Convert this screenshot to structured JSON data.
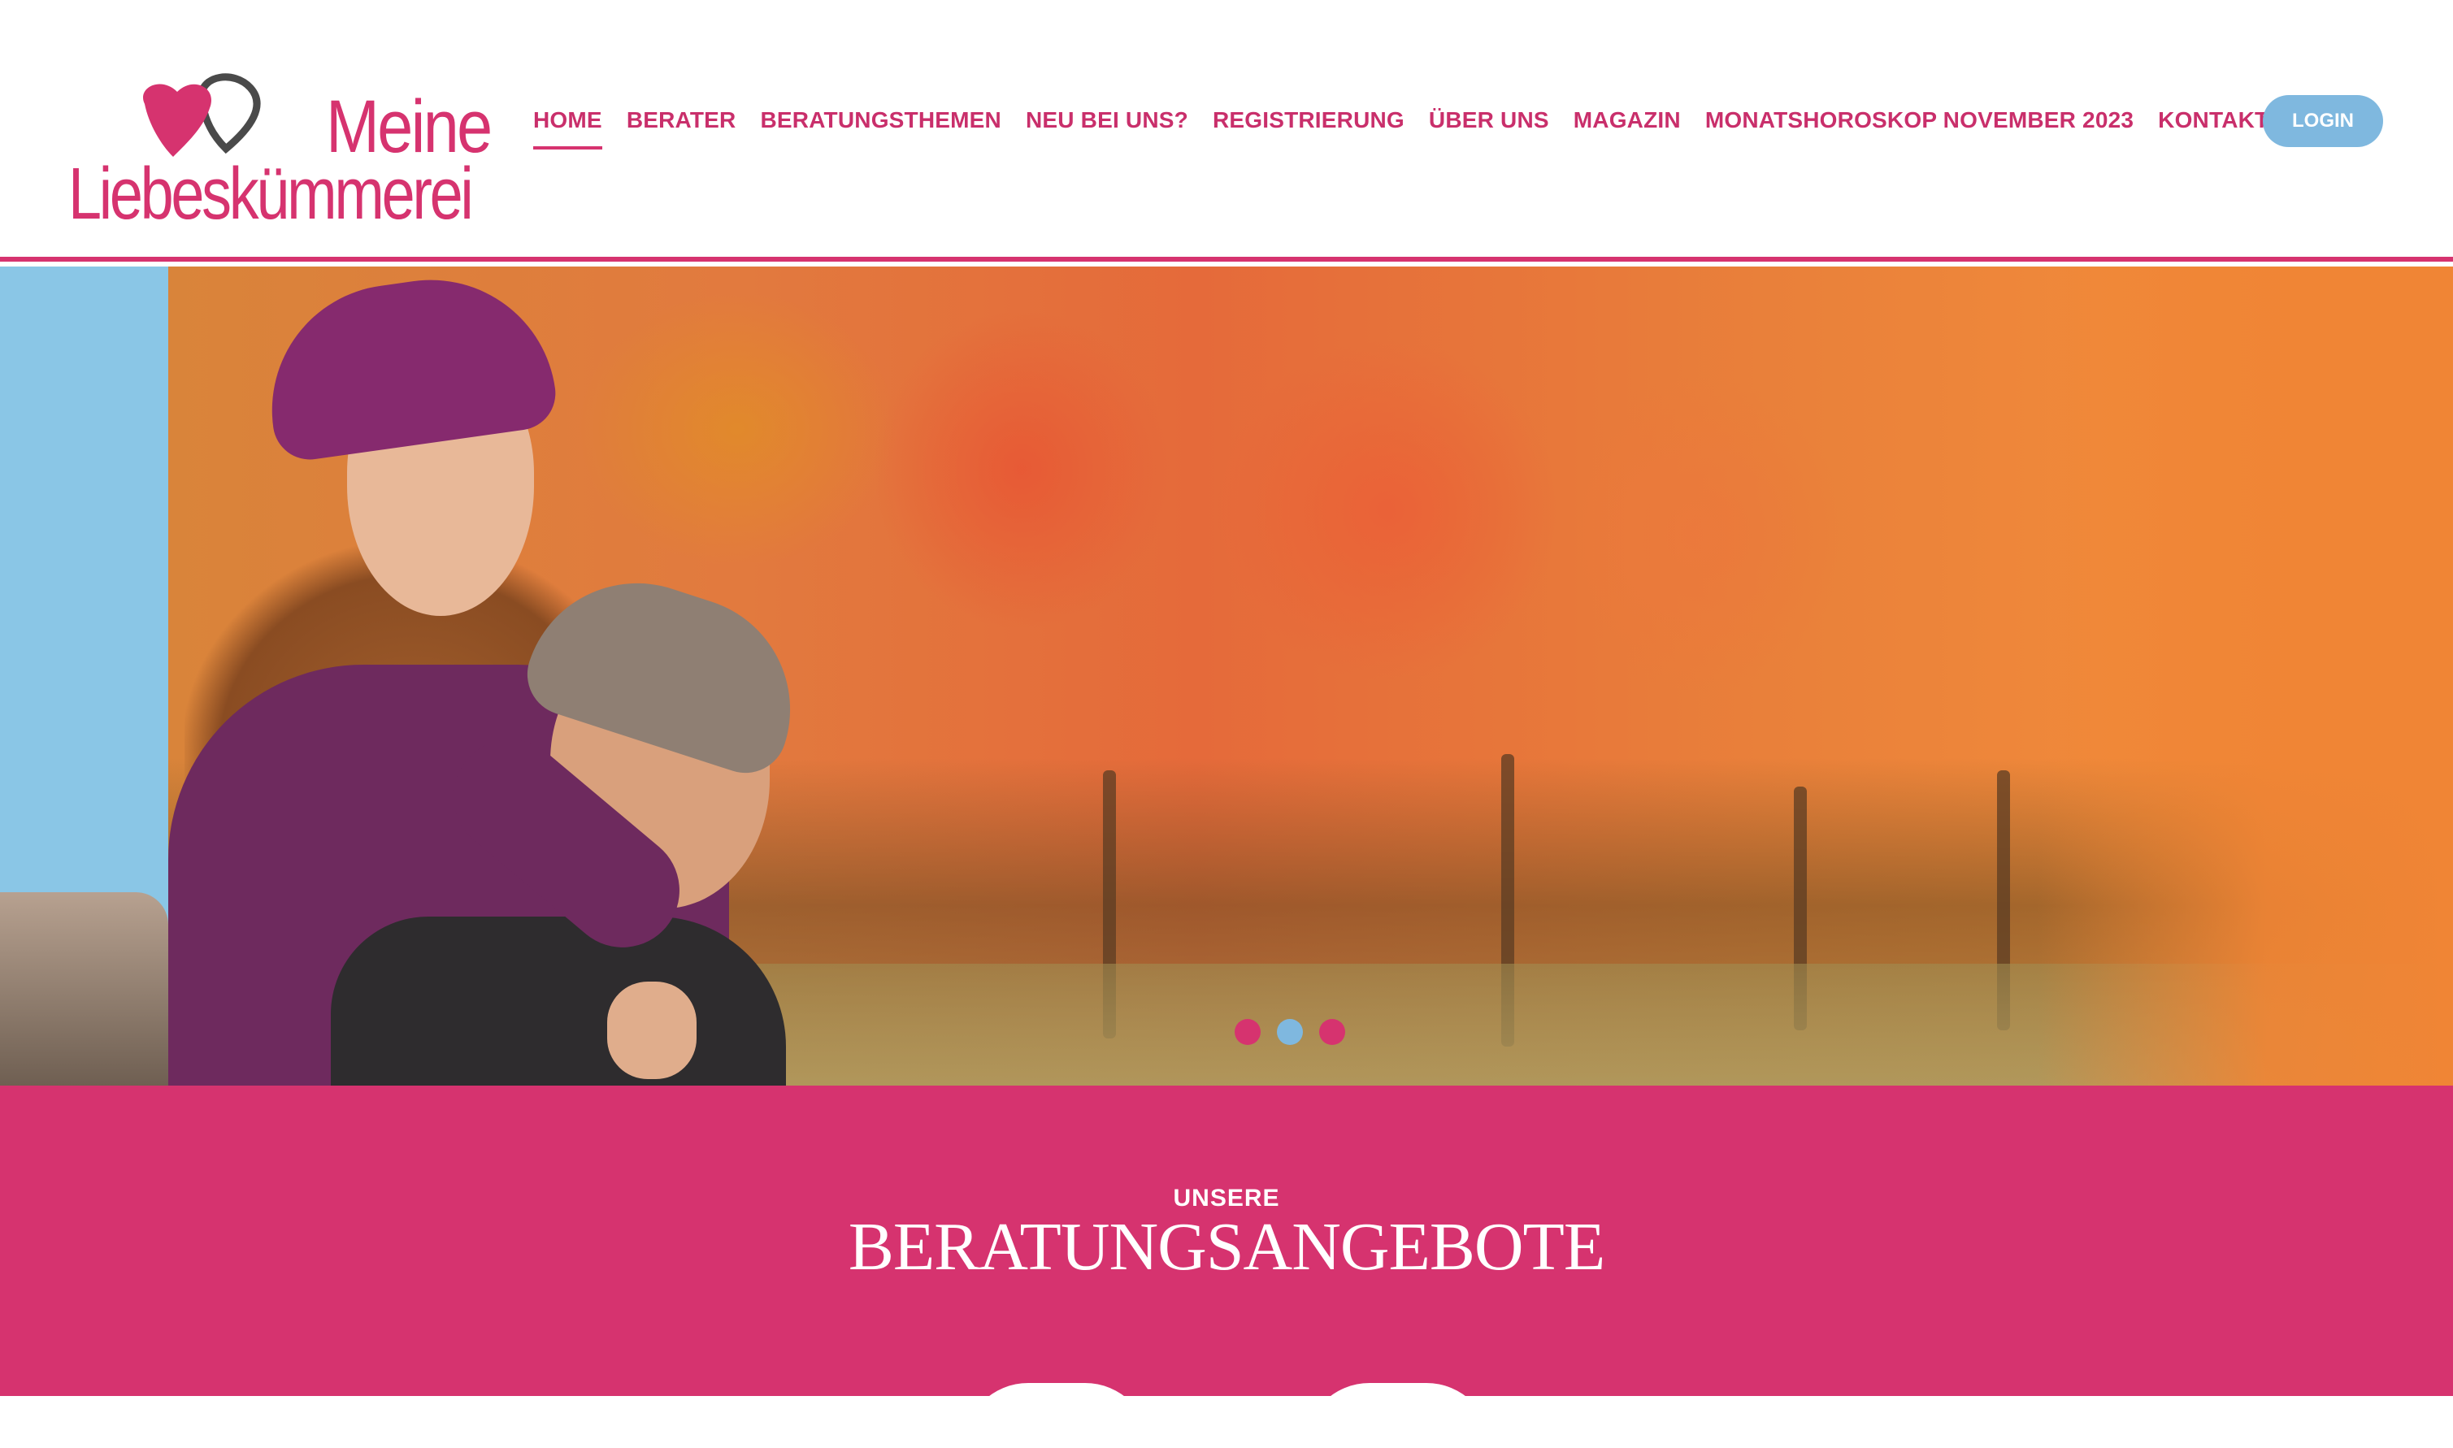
{
  "logo": {
    "line1": "Meine",
    "line2": "Liebeskümmerei",
    "icon": "two-hearts-icon",
    "colors": {
      "heart_pink": "#d6336f",
      "heart_outline": "#4a4a4a"
    }
  },
  "nav": {
    "items": [
      {
        "label": "HOME",
        "active": true
      },
      {
        "label": "BERATER"
      },
      {
        "label": "BERATUNGSTHEMEN"
      },
      {
        "label": "NEU BEI UNS?"
      },
      {
        "label": "REGISTRIERUNG"
      },
      {
        "label": "ÜBER UNS"
      },
      {
        "label": "MAGAZIN"
      },
      {
        "label": "MONATSHOROSKOP NOVEMBER 2023"
      },
      {
        "label": "KONTAKT"
      }
    ],
    "login_label": "LOGIN"
  },
  "hero": {
    "slider_dots": [
      {
        "color": "#d6336f",
        "active": false
      },
      {
        "color": "#7fb8df",
        "active": true
      },
      {
        "color": "#d6336f",
        "active": false
      }
    ]
  },
  "offers": {
    "kicker": "UNSERE",
    "title": "BERATUNGSANGEBOTE"
  },
  "colors": {
    "brand_pink": "#d6336f",
    "nav_text": "#c92f6b",
    "login_blue": "#7fb8df",
    "hero_side_blue": "#8ac6e6",
    "hero_orange": "#f08535"
  }
}
